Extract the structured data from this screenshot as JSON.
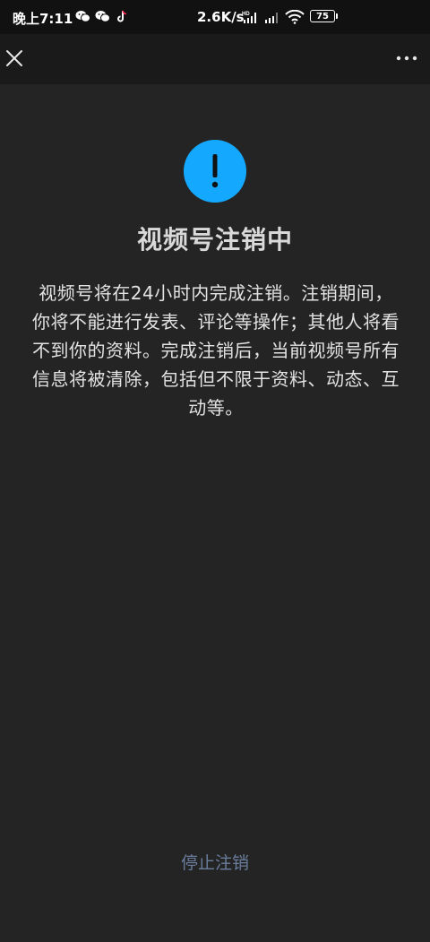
{
  "status_bar": {
    "time": "晚上7:11",
    "net_speed": "2.6K/s",
    "network_badge": "HD",
    "battery": "75",
    "app_icons": [
      "wechat-icon",
      "wechat-icon",
      "tiktok-icon"
    ]
  },
  "nav": {
    "close_icon": "close-icon",
    "more_icon": "more-icon"
  },
  "main": {
    "icon": "exclamation-icon",
    "icon_color": "#14a9ff",
    "title": "视频号注销中",
    "description": "视频号将在24小时内完成注销。注销期间，你将不能进行发表、评论等操作；其他人将看不到你的资料。完成注销后，当前视频号所有信息将被清除，包括但不限于资料、动态、互动等。",
    "stop_label": "停止注销"
  }
}
